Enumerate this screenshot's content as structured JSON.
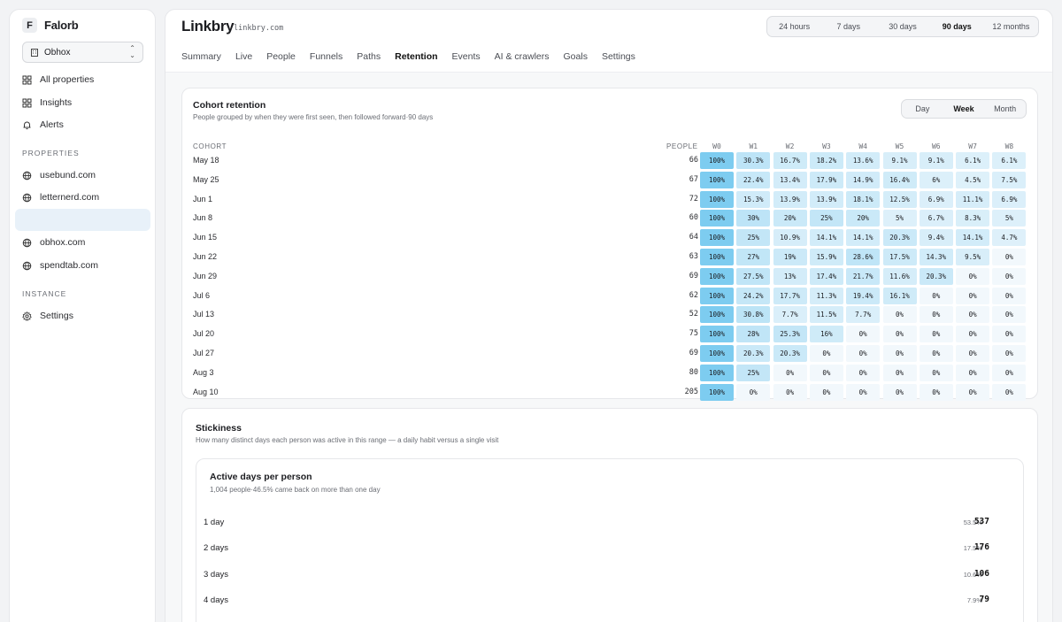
{
  "brand": {
    "initial": "F",
    "name": "Falorb"
  },
  "org": {
    "name": "Obhox"
  },
  "nav": [
    {
      "label": "All properties",
      "icon": "grid-icon"
    },
    {
      "label": "Insights",
      "icon": "grid-icon"
    },
    {
      "label": "Alerts",
      "icon": "bell-icon"
    }
  ],
  "properties_label": "PROPERTIES",
  "properties": [
    "usebund.com",
    "letternerd.com",
    "",
    "obhox.com",
    "spendtab.com"
  ],
  "instance_label": "INSTANCE",
  "instance": [
    {
      "label": "Settings",
      "icon": "gear-icon"
    }
  ],
  "site": {
    "title": "Linkbry",
    "domain": "linkbry.com"
  },
  "ranges": [
    "24 hours",
    "7 days",
    "30 days",
    "90 days",
    "12 months"
  ],
  "active_range": "90 days",
  "tabs": [
    "Summary",
    "Live",
    "People",
    "Funnels",
    "Paths",
    "Retention",
    "Events",
    "AI & crawlers",
    "Goals",
    "Settings"
  ],
  "active_tab": "Retention",
  "cohort": {
    "title": "Cohort retention",
    "subtitle": "People grouped by when they were first seen, then followed forward·90 days",
    "granularity": [
      "Day",
      "Week",
      "Month"
    ],
    "active_granularity": "Week",
    "col_cohort": "COHORT",
    "col_people": "PEOPLE",
    "weeks": [
      "W0",
      "W1",
      "W2",
      "W3",
      "W4",
      "W5",
      "W6",
      "W7",
      "W8"
    ],
    "rows": [
      {
        "cohort": "May 18",
        "people": "66",
        "values": [
          "100%",
          "30.3%",
          "16.7%",
          "18.2%",
          "13.6%",
          "9.1%",
          "9.1%",
          "6.1%",
          "6.1%"
        ]
      },
      {
        "cohort": "May 25",
        "people": "67",
        "values": [
          "100%",
          "22.4%",
          "13.4%",
          "17.9%",
          "14.9%",
          "16.4%",
          "6%",
          "4.5%",
          "7.5%"
        ]
      },
      {
        "cohort": "Jun 1",
        "people": "72",
        "values": [
          "100%",
          "15.3%",
          "13.9%",
          "13.9%",
          "18.1%",
          "12.5%",
          "6.9%",
          "11.1%",
          "6.9%"
        ]
      },
      {
        "cohort": "Jun 8",
        "people": "60",
        "values": [
          "100%",
          "30%",
          "20%",
          "25%",
          "20%",
          "5%",
          "6.7%",
          "8.3%",
          "5%"
        ]
      },
      {
        "cohort": "Jun 15",
        "people": "64",
        "values": [
          "100%",
          "25%",
          "10.9%",
          "14.1%",
          "14.1%",
          "20.3%",
          "9.4%",
          "14.1%",
          "4.7%"
        ]
      },
      {
        "cohort": "Jun 22",
        "people": "63",
        "values": [
          "100%",
          "27%",
          "19%",
          "15.9%",
          "28.6%",
          "17.5%",
          "14.3%",
          "9.5%",
          "0%"
        ]
      },
      {
        "cohort": "Jun 29",
        "people": "69",
        "values": [
          "100%",
          "27.5%",
          "13%",
          "17.4%",
          "21.7%",
          "11.6%",
          "20.3%",
          "0%",
          "0%"
        ]
      },
      {
        "cohort": "Jul 6",
        "people": "62",
        "values": [
          "100%",
          "24.2%",
          "17.7%",
          "11.3%",
          "19.4%",
          "16.1%",
          "0%",
          "0%",
          "0%"
        ]
      },
      {
        "cohort": "Jul 13",
        "people": "52",
        "values": [
          "100%",
          "30.8%",
          "7.7%",
          "11.5%",
          "7.7%",
          "0%",
          "0%",
          "0%",
          "0%"
        ]
      },
      {
        "cohort": "Jul 20",
        "people": "75",
        "values": [
          "100%",
          "28%",
          "25.3%",
          "16%",
          "0%",
          "0%",
          "0%",
          "0%",
          "0%"
        ]
      },
      {
        "cohort": "Jul 27",
        "people": "69",
        "values": [
          "100%",
          "20.3%",
          "20.3%",
          "0%",
          "0%",
          "0%",
          "0%",
          "0%",
          "0%"
        ]
      },
      {
        "cohort": "Aug 3",
        "people": "80",
        "values": [
          "100%",
          "25%",
          "0%",
          "0%",
          "0%",
          "0%",
          "0%",
          "0%",
          "0%"
        ]
      },
      {
        "cohort": "Aug 10",
        "people": "205",
        "values": [
          "100%",
          "0%",
          "0%",
          "0%",
          "0%",
          "0%",
          "0%",
          "0%",
          "0%"
        ]
      }
    ]
  },
  "stickiness": {
    "title": "Stickiness",
    "subtitle": "How many distinct days each person was active in this range — a daily habit versus a single visit",
    "inner_title": "Active days per person",
    "inner_subtitle": "1,004 people·46.5% came back on more than one day",
    "rows": [
      {
        "label": "1 day",
        "pct": "53.5%",
        "count": "537"
      },
      {
        "label": "2 days",
        "pct": "17.5%",
        "count": "176"
      },
      {
        "label": "3 days",
        "pct": "10.6%",
        "count": "106"
      },
      {
        "label": "4 days",
        "pct": "7.9%",
        "count": "79"
      }
    ]
  },
  "colors": {
    "accent": "#1c1d21",
    "heat_max": "#7dccf0",
    "heat_min": "#f2f8fc",
    "active_nav": "#e8f1f9"
  }
}
